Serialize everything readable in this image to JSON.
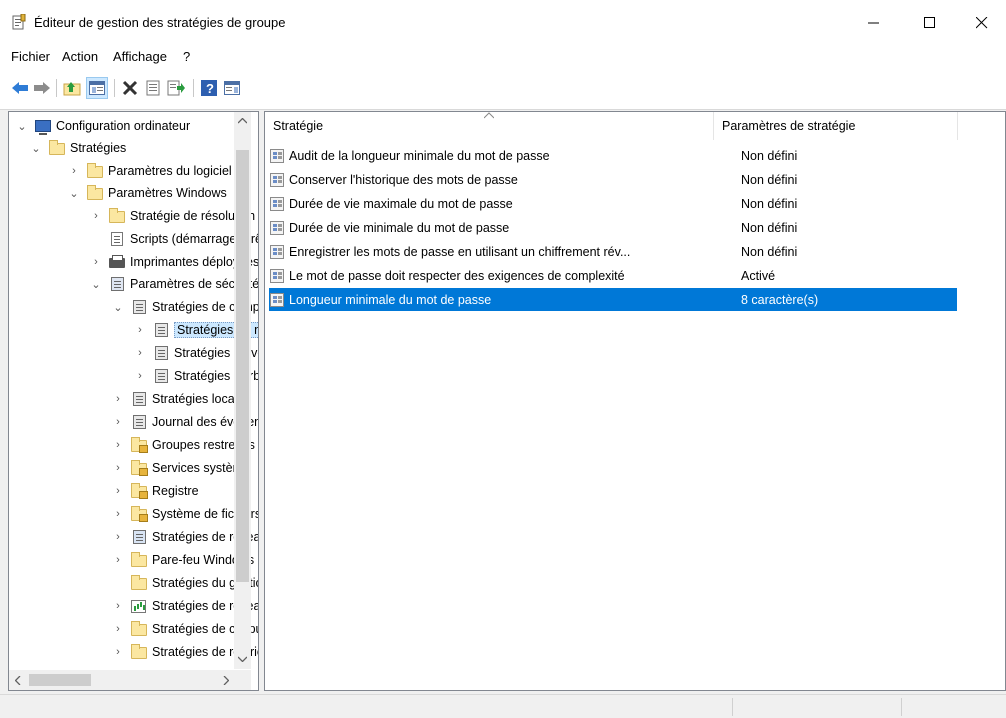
{
  "window": {
    "title": "Éditeur de gestion des stratégies de groupe",
    "controls": {
      "minimize": "–",
      "maximize": "☐",
      "close": "✕"
    }
  },
  "menu": [
    "Fichier",
    "Action",
    "Affichage",
    "?"
  ],
  "toolbar": [
    "back-arrow-icon",
    "forward-arrow-icon",
    "up-folder-icon",
    "show-hide-tree-icon",
    "delete-icon",
    "properties-icon",
    "export-list-icon",
    "help-icon",
    "show-hide-action-pane-icon"
  ],
  "tree": [
    {
      "label": "Configuration ordinateur",
      "expanded": true,
      "icon": "computer-icon"
    },
    {
      "label": "Stratégies",
      "expanded": true,
      "icon": "folder-icon"
    },
    {
      "label": "Paramètres du logiciel",
      "icon": "folder-icon"
    },
    {
      "label": "Paramètres Windows",
      "expanded": true,
      "icon": "folder-icon"
    },
    {
      "label": "Stratégie de résolution de noms",
      "icon": "folder-icon"
    },
    {
      "label": "Scripts (démarrage/arrêt)",
      "icon": "script-icon"
    },
    {
      "label": "Imprimantes déployées",
      "icon": "printer-icon"
    },
    {
      "label": "Paramètres de sécurité",
      "expanded": true,
      "icon": "security-icon"
    },
    {
      "label": "Stratégies de comptes",
      "expanded": true,
      "icon": "policy-stack-icon"
    },
    {
      "label": "Stratégies de mot de passe",
      "selected": true,
      "icon": "policy-stack-icon"
    },
    {
      "label": "Stratégies de verrouillage du compte",
      "icon": "policy-stack-icon"
    },
    {
      "label": "Stratégies Kerberos",
      "icon": "policy-stack-icon"
    },
    {
      "label": "Stratégies locales",
      "icon": "policy-stack-icon"
    },
    {
      "label": "Journal des événements",
      "icon": "policy-stack-icon"
    },
    {
      "label": "Groupes restreints",
      "icon": "locked-folder-icon"
    },
    {
      "label": "Services système",
      "icon": "locked-folder-icon"
    },
    {
      "label": "Registre",
      "icon": "locked-folder-icon"
    },
    {
      "label": "Système de fichiers",
      "icon": "locked-folder-icon"
    },
    {
      "label": "Stratégies de réseau filaire",
      "icon": "policy-stack-icon"
    },
    {
      "label": "Pare-feu Windows Defender",
      "icon": "folder-icon"
    },
    {
      "label": "Stratégies du gestionnaire de listes de réseaux",
      "icon": "folder-icon"
    },
    {
      "label": "Stratégies de réseau sans fil",
      "icon": "chart-icon"
    },
    {
      "label": "Stratégies de clé publique",
      "icon": "folder-icon"
    },
    {
      "label": "Stratégies de restriction logicielle",
      "icon": "folder-icon"
    }
  ],
  "list": {
    "columns": {
      "name": "Stratégie",
      "value": "Paramètres de stratégie"
    },
    "rows": [
      {
        "name": "Audit de la longueur minimale du mot de passe",
        "value": "Non défini"
      },
      {
        "name": "Conserver l'historique des mots de passe",
        "value": "Non défini"
      },
      {
        "name": "Durée de vie maximale du mot de passe",
        "value": "Non défini"
      },
      {
        "name": "Durée de vie minimale du mot de passe",
        "value": "Non défini"
      },
      {
        "name": "Enregistrer les mots de passe en utilisant un chiffrement rév...",
        "value": "Non défini"
      },
      {
        "name": "Le mot de passe doit respecter des exigences de complexité",
        "value": "Activé"
      },
      {
        "name": "Longueur minimale du mot de passe",
        "value": "8 caractère(s)",
        "selected": true
      }
    ]
  },
  "colors": {
    "selection": "#0078d7",
    "tree_selection": "#cce8ff"
  }
}
